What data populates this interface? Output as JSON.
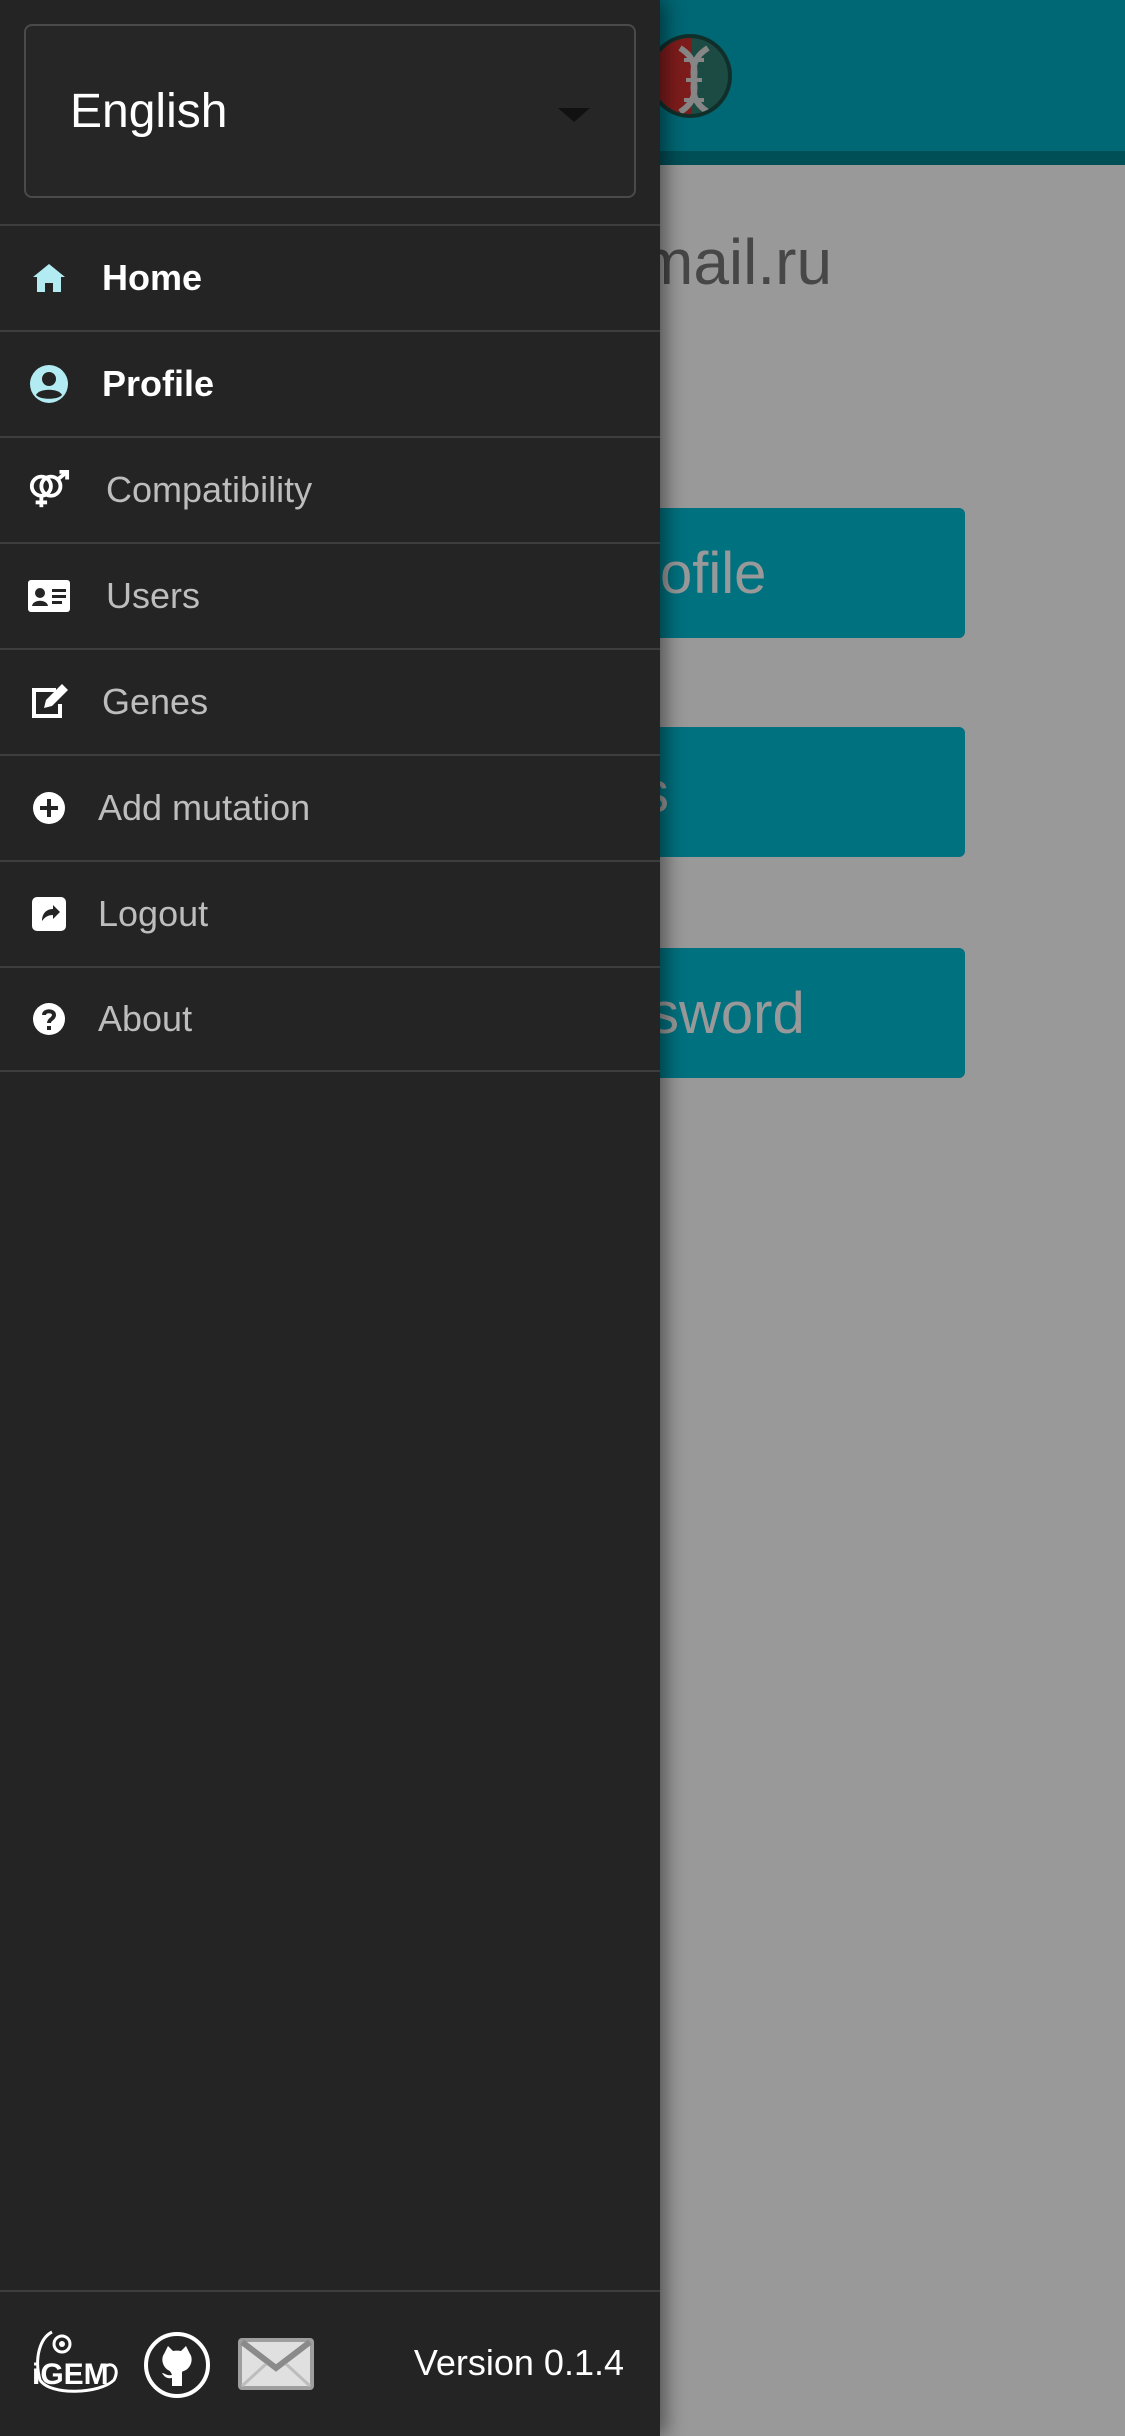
{
  "background": {
    "email_fragment": "mail.ru",
    "buttons": [
      {
        "visible_label": "ofile"
      },
      {
        "visible_label": "s"
      },
      {
        "visible_label": "sword"
      }
    ]
  },
  "drawer": {
    "language_select": {
      "value": "English"
    },
    "menu": [
      {
        "label": "Home",
        "icon": "home-icon",
        "active": true
      },
      {
        "label": "Profile",
        "icon": "user-circle-icon",
        "active": true
      },
      {
        "label": "Compatibility",
        "icon": "venus-mars-icon",
        "active": false
      },
      {
        "label": "Users",
        "icon": "id-card-icon",
        "active": false
      },
      {
        "label": "Genes",
        "icon": "edit-icon",
        "active": false
      },
      {
        "label": "Add mutation",
        "icon": "plus-circle-icon",
        "active": false
      },
      {
        "label": "Logout",
        "icon": "share-square-icon",
        "active": false
      },
      {
        "label": "About",
        "icon": "question-circle-icon",
        "active": false
      }
    ],
    "footer": {
      "igem_logo_text": "iGEM",
      "version": "Version 0.1.4"
    }
  },
  "colors": {
    "accent": "#00bcd4",
    "header": "#00acc1",
    "drawer_bg": "#242424",
    "active_icon": "#b2ebf2"
  }
}
